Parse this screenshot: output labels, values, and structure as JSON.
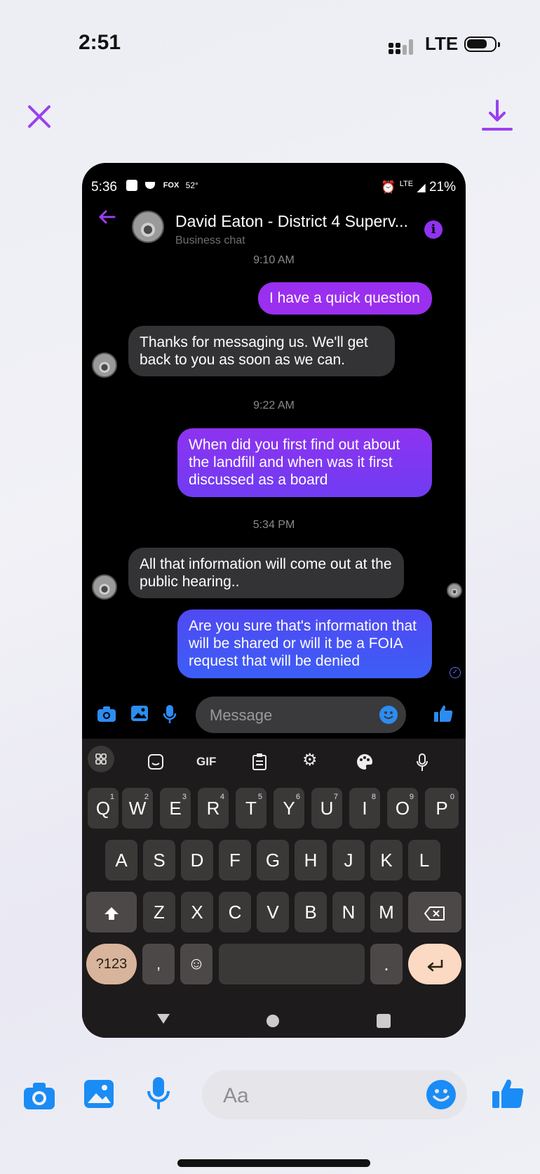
{
  "status_bar": {
    "time": "2:51",
    "network": "LTE"
  },
  "viewer": {
    "close_icon": "close-icon",
    "download_icon": "download-icon"
  },
  "screenshot": {
    "status": {
      "time": "5:36",
      "temp": "52°",
      "network": "LTE",
      "battery": "21%",
      "fox": "FOX"
    },
    "header": {
      "name": "David Eaton - District 4 Superv...",
      "subtitle": "Business chat"
    },
    "messages": [
      {
        "type": "time",
        "text": "9:10 AM"
      },
      {
        "type": "out",
        "text": "I have a quick question"
      },
      {
        "type": "in",
        "text": "Thanks for messaging us. We'll get back to you as soon as we can."
      },
      {
        "type": "time",
        "text": "9:22 AM"
      },
      {
        "type": "out",
        "text": "When did you first find out about the landfill and when was it first discussed as a board"
      },
      {
        "type": "time",
        "text": "5:34 PM"
      },
      {
        "type": "in",
        "text": "All that information will come out at the public hearing.."
      },
      {
        "type": "out",
        "text": "Are you sure that's information that will be shared or will it be a FOIA request that will be denied"
      }
    ],
    "composer": {
      "placeholder": "Message"
    },
    "keyboard": {
      "gif": "GIF",
      "row1": [
        "Q",
        "W",
        "E",
        "R",
        "T",
        "Y",
        "U",
        "I",
        "O",
        "P"
      ],
      "row1_hints": [
        "1",
        "2",
        "3",
        "4",
        "5",
        "6",
        "7",
        "8",
        "9",
        "0"
      ],
      "row2": [
        "A",
        "S",
        "D",
        "F",
        "G",
        "H",
        "J",
        "K",
        "L"
      ],
      "row3": [
        "Z",
        "X",
        "C",
        "V",
        "B",
        "N",
        "M"
      ],
      "numbers_key": "?123",
      "comma": ",",
      "period": "."
    }
  },
  "composer": {
    "placeholder": "Aa"
  },
  "colors": {
    "accent": "#9b3ff0",
    "out_bubble_top": "#9a2ff0",
    "out_bubble_bottom": "#3f5cf5",
    "messenger_blue": "#1a8cf5"
  }
}
